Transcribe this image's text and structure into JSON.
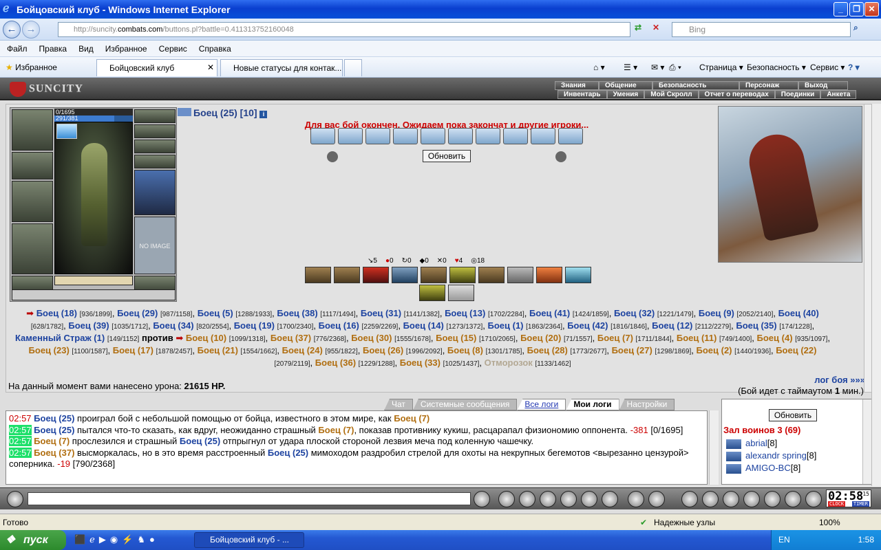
{
  "window": {
    "title": "Бойцовский клуб - Windows Internet Explorer"
  },
  "address": {
    "url_pre": "http://suncity.",
    "url_domain": "combats.com",
    "url_post": "/buttons.pl?battle=0.411313752160048",
    "search_placeholder": "Bing"
  },
  "menu": [
    "Файл",
    "Правка",
    "Вид",
    "Избранное",
    "Сервис",
    "Справка"
  ],
  "favbar": {
    "favorites": "Избранное",
    "tab1": "Бойцовский клуб",
    "tab2": "Новые статусы для контак...",
    "page": "Страница",
    "safety": "Безопасность",
    "service": "Сервис"
  },
  "game": {
    "logo": "SUNCITY",
    "topmenu": [
      "Знания",
      "Общение",
      "Безопасность",
      "Персонаж",
      "Выход"
    ],
    "submenu": [
      "Инвентарь",
      "Умения",
      "Мой Скролл",
      "Отчет о переводах",
      "Поединки",
      "Анкета"
    ],
    "hp": "0/1695",
    "mana": "291/381",
    "mana_fraction": 0.764,
    "noimage": "NO IMAGE",
    "enemy": "Боец (25) [10]",
    "battle_msg": "Для вас бой окончен. Ожидаем пока закончат и другие игроки...",
    "refresh": "Обновить",
    "stats": [
      "5",
      "0",
      "0",
      "0",
      "0",
      "4",
      "18"
    ],
    "damage_label": "На данный момент вами нанесено урона:",
    "damage_value": "21615 HP.",
    "log_link": "лог боя »»»",
    "timeout_pre": "(Бой идет с таймаутом",
    "timeout_num": "1",
    "timeout_post": "мин.)"
  },
  "teams": {
    "team1": [
      [
        "Боец (18)",
        "[936/1899]"
      ],
      [
        "Боец (29)",
        "[987/1158]"
      ],
      [
        "Боец (5)",
        "[1288/1933]"
      ],
      [
        "Боец (38)",
        "[1117/1494]"
      ],
      [
        "Боец (31)",
        "[1141/1382]"
      ],
      [
        "Боец (13)",
        "[1702/2284]"
      ],
      [
        "Боец (41)",
        "[1424/1859]"
      ],
      [
        "Боец (32)",
        "[1221/1479]"
      ],
      [
        "Боец (9)",
        "[2052/2140]"
      ],
      [
        "Боец (40)",
        "[628/1782]"
      ],
      [
        "Боец (39)",
        "[1035/1712]"
      ],
      [
        "Боец (34)",
        "[820/2554]"
      ],
      [
        "Боец (19)",
        "[1700/2340]"
      ],
      [
        "Боец (16)",
        "[2259/2269]"
      ],
      [
        "Боец (14)",
        "[1273/1372]"
      ],
      [
        "Боец (1)",
        "[1863/2364]"
      ],
      [
        "Боец (42)",
        "[1816/1846]"
      ],
      [
        "Боец (12)",
        "[2112/2279]"
      ],
      [
        "Боец (35)",
        "[174/1228]"
      ],
      [
        "Каменный Страж (1)",
        "[149/1152]"
      ]
    ],
    "versus": "против",
    "team2": [
      [
        "Боец (10)",
        "[1099/1318]"
      ],
      [
        "Боец (37)",
        "[776/2368]"
      ],
      [
        "Боец (30)",
        "[1555/1678]"
      ],
      [
        "Боец (15)",
        "[1710/2065]"
      ],
      [
        "Боец (20)",
        "[71/1557]"
      ],
      [
        "Боец (7)",
        "[1711/1844]"
      ],
      [
        "Боец (11)",
        "[749/1400]"
      ],
      [
        "Боец (4)",
        "[935/1097]"
      ],
      [
        "Боец (23)",
        "[1100/1587]"
      ],
      [
        "Боец (17)",
        "[1878/2457]"
      ],
      [
        "Боец (21)",
        "[1554/1662]"
      ],
      [
        "Боец (24)",
        "[955/1822]"
      ],
      [
        "Боец (26)",
        "[1996/2092]"
      ],
      [
        "Боец (8)",
        "[1301/1785]"
      ],
      [
        "Боец (28)",
        "[1773/2677]"
      ],
      [
        "Боец (27)",
        "[1298/1869]"
      ],
      [
        "Боец (2)",
        "[1440/1936]"
      ],
      [
        "Боец (22)",
        "[2079/2119]"
      ],
      [
        "Боец (36)",
        "[1229/1288]"
      ],
      [
        "Боец (33)",
        "[1025/1437]"
      ]
    ],
    "frozen": "Отморозок",
    "frozen_hp": "[1133/1462]"
  },
  "chat": {
    "tabs": [
      "Чат",
      "Системные сообщения",
      "Все логи",
      "Мои логи",
      "Настройки"
    ],
    "lines": [
      {
        "time": "02:57",
        "a": "Боец (25)",
        "t1": " проиграл бой с небольшой помощью от бойца, известного в этом мире, как ",
        "b": "Боец (7)",
        "t2": "",
        "dmg": "",
        "hp": ""
      },
      {
        "time": "02:57",
        "a": "Боец (25)",
        "t1": " пытался что-то сказать, как вдруг, неожиданно страшный ",
        "b": "Боец (7)",
        "t2": ", показав противнику кукиш, расцарапал физиономию оппонента. ",
        "dmg": "-381",
        "hp": " [0/1695]"
      },
      {
        "time": "02:57",
        "a": "Боец (7)",
        "t1": " прослезился и страшный ",
        "b": "Боец (25)",
        "t2": " отпрыгнул от удара плоской стороной лезвия меча под коленную чашечку.",
        "dmg": "",
        "hp": ""
      },
      {
        "time": "02:57",
        "a": "Боец (37)",
        "t1": " высморкалась, но в это время расстроенный ",
        "b": "Боец (25)",
        "t2": " мимоходом раздробил стрелой для охоты на некрупных бегемотов <вырезанно цензурой> соперника. ",
        "dmg": "-19",
        "hp": " [790/2368]"
      }
    ],
    "refresh": "Обновить",
    "hall": "Зал воинов 3 (69)",
    "players": [
      [
        "abrial",
        "[8]"
      ],
      [
        "alexandr spring",
        "[8]"
      ],
      [
        "AMIGO-BC",
        "[8]"
      ]
    ]
  },
  "clock": {
    "time": "02:58",
    "sec": "15",
    "clock": "CLOCK",
    "timer": "TIMER"
  },
  "status": {
    "ready": "Готово",
    "zone": "Надежные узлы",
    "zoom": "100%"
  },
  "taskbar": {
    "start": "пуск",
    "item": "Бойцовский клуб - ...",
    "lang": "EN",
    "time": "1:58"
  }
}
